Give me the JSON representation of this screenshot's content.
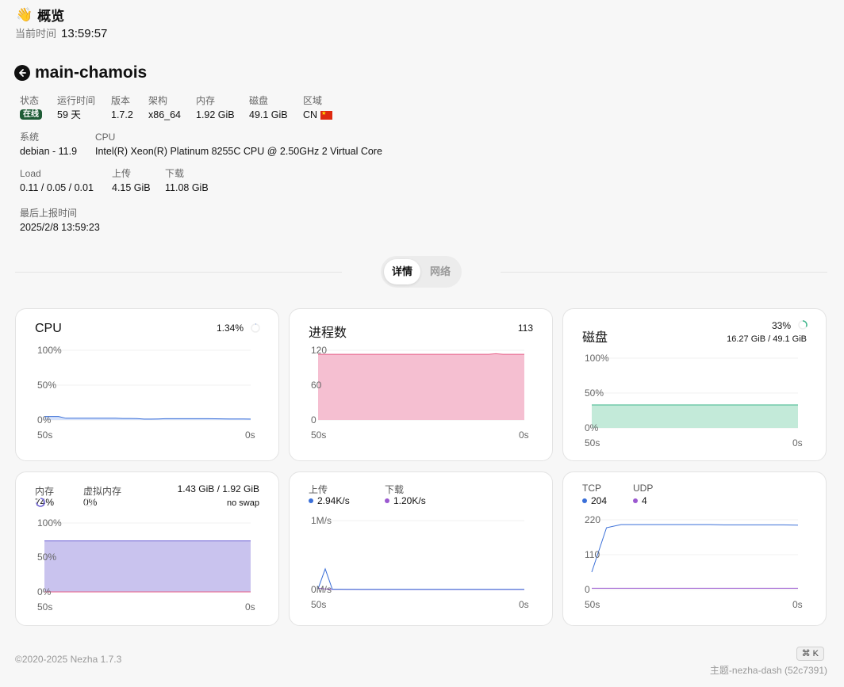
{
  "header": {
    "emoji": "👋",
    "title": "概览",
    "time_label": "当前时间",
    "time_value": "13:59:57"
  },
  "server": {
    "name": "main-chamois",
    "info": [
      {
        "label": "状态",
        "value": "在线",
        "badge": true
      },
      {
        "label": "运行时间",
        "value": "59 天"
      },
      {
        "label": "版本",
        "value": "1.7.2"
      },
      {
        "label": "架构",
        "value": "x86_64"
      },
      {
        "label": "内存",
        "value": "1.92 GiB"
      },
      {
        "label": "磁盘",
        "value": "49.1 GiB"
      },
      {
        "label": "区域",
        "value": "CN",
        "flag": true
      },
      {
        "label": "系统",
        "value": "debian - 11.9"
      },
      {
        "label": "CPU",
        "value": "Intel(R) Xeon(R) Platinum 8255C CPU @ 2.50GHz 2 Virtual Core"
      },
      {
        "label": "Load",
        "value": "0.11 / 0.05 / 0.01"
      },
      {
        "label": "上传",
        "value": "4.15 GiB"
      },
      {
        "label": "下载",
        "value": "11.08 GiB"
      },
      {
        "label": "最后上报时间",
        "value": "2025/2/8 13:59:23"
      }
    ]
  },
  "tabs": [
    {
      "label": "详情",
      "active": true
    },
    {
      "label": "网络",
      "active": false
    }
  ],
  "cards": {
    "cpu": {
      "title": "CPU",
      "value": "1.34%",
      "usage": 0.0134,
      "y_ticks": [
        "100%",
        "50%",
        "0%"
      ],
      "x_start": "50s",
      "x_end": "0s",
      "color": "#3a6fd8",
      "series": [
        5,
        5,
        5,
        2.5,
        2.5,
        2.5,
        2.5,
        2.5,
        2.5,
        2.5,
        2.5,
        2.2,
        2.2,
        2,
        1.3,
        1.3,
        1.5,
        1.8,
        1.8,
        1.8,
        1.8,
        1.8,
        1.8,
        1.8,
        1.7,
        1.6,
        1.5,
        1.4,
        1.4,
        1.3
      ]
    },
    "processes": {
      "title": "进程数",
      "value": "113",
      "y_ticks": [
        "120",
        "60",
        "0"
      ],
      "x_start": "50s",
      "x_end": "0s",
      "color": "#e8628a",
      "fill": "#f5bfd1",
      "series": [
        113,
        113,
        113,
        113,
        113,
        113,
        113,
        113,
        113,
        113,
        113,
        113,
        113,
        113,
        113,
        113,
        113,
        113,
        113,
        113,
        113,
        113,
        113,
        113,
        113,
        114,
        113,
        113,
        113,
        113
      ]
    },
    "disk": {
      "title": "磁盘",
      "value": "33%",
      "usage": 0.33,
      "detail": "16.27 GiB / 49.1 GiB",
      "y_ticks": [
        "100%",
        "50%",
        "0%"
      ],
      "x_start": "50s",
      "x_end": "0s",
      "color": "#3bb58a",
      "fill": "#c3ead9",
      "series": [
        33,
        33,
        33,
        33,
        33,
        33,
        33,
        33,
        33,
        33,
        33,
        33,
        33,
        33,
        33,
        33,
        33,
        33,
        33,
        33,
        33,
        33,
        33,
        33,
        33,
        33,
        33,
        33,
        33,
        33
      ]
    },
    "memory": {
      "mem_label": "内存",
      "mem_value": "74%",
      "mem_usage": 0.74,
      "swap_label": "虚拟内存",
      "swap_value": "0%",
      "swap_usage": 0,
      "detail": "1.43 GiB / 1.92 GiB",
      "swap_detail": "no swap",
      "y_ticks": [
        "100%",
        "50%",
        "0%"
      ],
      "x_start": "50s",
      "x_end": "0s",
      "mem_color": "#6b5fd4",
      "mem_fill": "#c9c3ee",
      "swap_color": "#e8628a",
      "series": [
        74,
        74,
        74,
        74,
        74,
        74,
        74,
        74,
        74,
        74,
        74,
        74,
        74,
        74,
        74,
        74,
        74,
        74,
        74,
        74,
        74,
        74,
        74,
        74,
        74,
        74,
        74,
        74,
        74,
        74
      ],
      "swap_series": [
        0,
        0,
        0,
        0,
        0,
        0,
        0,
        0,
        0,
        0,
        0,
        0,
        0,
        0,
        0,
        0,
        0,
        0,
        0,
        0,
        0,
        0,
        0,
        0,
        0,
        0,
        0,
        0,
        0,
        0
      ]
    },
    "network": {
      "up_label": "上传",
      "up_value": "2.94K/s",
      "down_label": "下载",
      "down_value": "1.20K/s",
      "y_ticks": [
        "1M/s",
        "0M/s"
      ],
      "x_start": "50s",
      "x_end": "0s",
      "up_color": "#3a6fd8",
      "down_color": "#9b59d0",
      "up_series_kbps": [
        10,
        300,
        5,
        5,
        4,
        4,
        4,
        4,
        4,
        4,
        3,
        3,
        3,
        3,
        3,
        3,
        3,
        3,
        3,
        3,
        3,
        3,
        3,
        3,
        3,
        3,
        3,
        3,
        3,
        3
      ],
      "down_series_kbps": [
        20,
        8,
        2,
        2,
        2,
        2,
        1,
        1,
        1,
        1,
        1,
        1,
        1,
        1,
        1,
        1,
        1,
        1,
        1,
        1,
        1,
        1,
        1,
        1,
        1,
        1,
        1,
        1,
        1,
        1
      ]
    },
    "connections": {
      "tcp_label": "TCP",
      "tcp_value": "204",
      "udp_label": "UDP",
      "udp_value": "4",
      "y_ticks": [
        "220",
        "110",
        "0"
      ],
      "x_start": "50s",
      "x_end": "0s",
      "tcp_color": "#3a6fd8",
      "udp_color": "#9b59d0",
      "tcp_series": [
        55,
        195,
        205,
        205,
        205,
        205,
        205,
        205,
        205,
        204,
        204,
        204,
        204,
        204,
        203
      ],
      "udp_series": [
        4,
        4,
        4,
        4,
        4,
        4,
        4,
        4,
        4,
        4,
        4,
        4,
        4,
        4,
        4
      ]
    }
  },
  "footer": {
    "copyright": "©2020-2025 Nezha 1.7.3",
    "theme": "主题-nezha-dash (52c7391)",
    "shortcut": "⌘ K"
  }
}
